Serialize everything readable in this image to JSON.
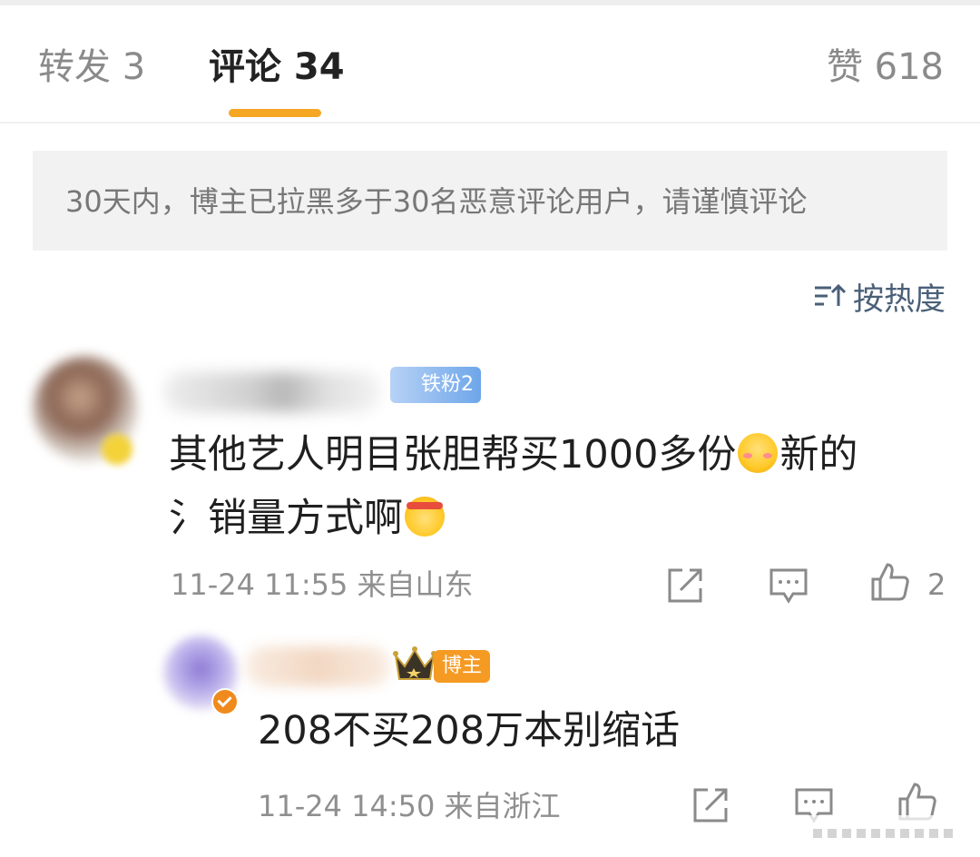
{
  "tabs": {
    "repost": "转发 3",
    "comments": "评论 34",
    "likes": "赞 618"
  },
  "notice": "30天内，博主已拉黑多于30名恶意评论用户，请谨慎评论",
  "sort": {
    "label": "按热度",
    "icon": "sort-icon"
  },
  "comment": {
    "fan_badge": "铁粉2",
    "text_line1": "其他艺人明目张胆帮买1000多份",
    "text_line1b": "新的",
    "text_line2": "氵销量方式啊",
    "emoji1": "blush-emoji-icon",
    "emoji2": "headband-emoji-icon",
    "time": "11-24 11:55",
    "location": "来自山东",
    "like_count": "2"
  },
  "reply": {
    "owner_badge": "博主",
    "text": "208不买208万本别缩话",
    "time": "11-24 14:50",
    "location": "来自浙江"
  },
  "colors": {
    "accent": "#f5a623",
    "sort_text": "#4a5f78",
    "notice_bg": "#f2f2f2",
    "owner_badge": "#f59a23",
    "fan_badge": "#6ea6ea"
  }
}
